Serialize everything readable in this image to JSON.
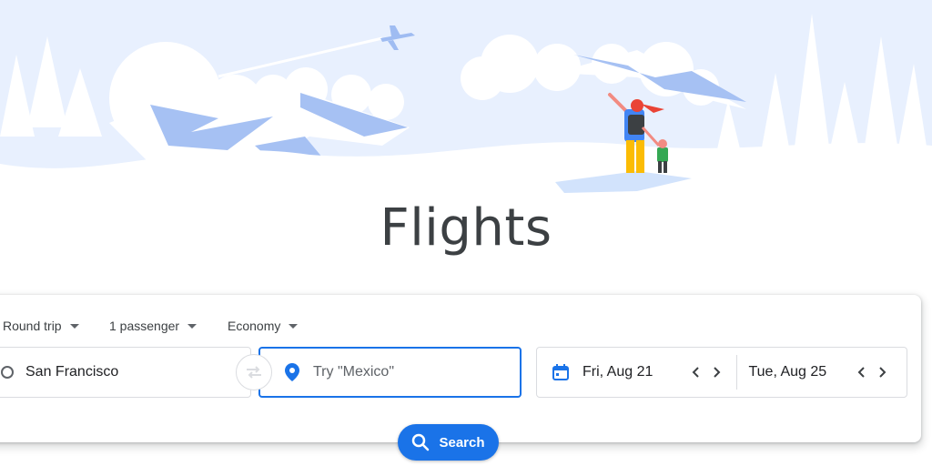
{
  "hero": {
    "illustration": "mountains-and-travelers-illustration"
  },
  "page": {
    "title": "Flights"
  },
  "search_form": {
    "trip_type": "Round trip",
    "passengers": "1 passenger",
    "cabin_class": "Economy",
    "origin": {
      "value": "San Francisco",
      "icon": "origin-circle-icon"
    },
    "destination": {
      "value": "",
      "placeholder": "Try \"Mexico\"",
      "icon": "location-pin-icon"
    },
    "departure_date": "Fri, Aug 21",
    "return_date": "Tue, Aug 25",
    "search_label": "Search"
  },
  "colors": {
    "accent": "#1a73e8",
    "text": "#3c4043",
    "border": "#dadce0",
    "sky": "#e8f0fe"
  }
}
